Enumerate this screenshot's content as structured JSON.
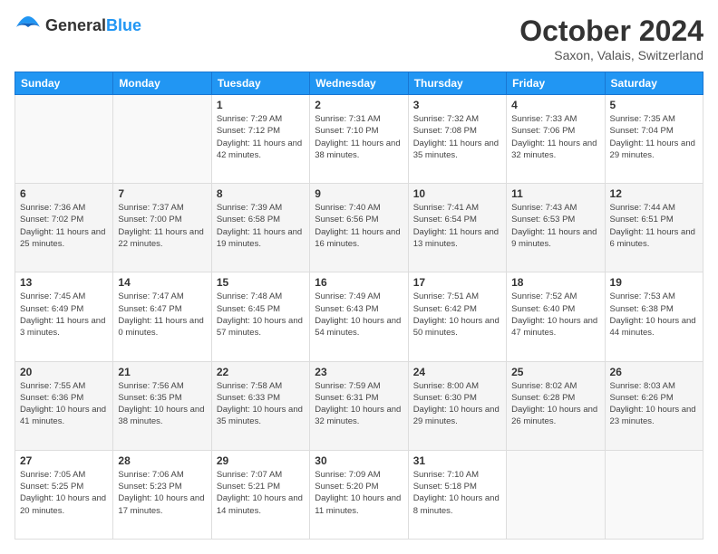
{
  "header": {
    "logo": {
      "general": "General",
      "blue": "Blue"
    },
    "title": "October 2024",
    "location": "Saxon, Valais, Switzerland"
  },
  "weekdays": [
    "Sunday",
    "Monday",
    "Tuesday",
    "Wednesday",
    "Thursday",
    "Friday",
    "Saturday"
  ],
  "weeks": [
    [
      {
        "day": "",
        "sunrise": "",
        "sunset": "",
        "daylight": ""
      },
      {
        "day": "",
        "sunrise": "",
        "sunset": "",
        "daylight": ""
      },
      {
        "day": "1",
        "sunrise": "Sunrise: 7:29 AM",
        "sunset": "Sunset: 7:12 PM",
        "daylight": "Daylight: 11 hours and 42 minutes."
      },
      {
        "day": "2",
        "sunrise": "Sunrise: 7:31 AM",
        "sunset": "Sunset: 7:10 PM",
        "daylight": "Daylight: 11 hours and 38 minutes."
      },
      {
        "day": "3",
        "sunrise": "Sunrise: 7:32 AM",
        "sunset": "Sunset: 7:08 PM",
        "daylight": "Daylight: 11 hours and 35 minutes."
      },
      {
        "day": "4",
        "sunrise": "Sunrise: 7:33 AM",
        "sunset": "Sunset: 7:06 PM",
        "daylight": "Daylight: 11 hours and 32 minutes."
      },
      {
        "day": "5",
        "sunrise": "Sunrise: 7:35 AM",
        "sunset": "Sunset: 7:04 PM",
        "daylight": "Daylight: 11 hours and 29 minutes."
      }
    ],
    [
      {
        "day": "6",
        "sunrise": "Sunrise: 7:36 AM",
        "sunset": "Sunset: 7:02 PM",
        "daylight": "Daylight: 11 hours and 25 minutes."
      },
      {
        "day": "7",
        "sunrise": "Sunrise: 7:37 AM",
        "sunset": "Sunset: 7:00 PM",
        "daylight": "Daylight: 11 hours and 22 minutes."
      },
      {
        "day": "8",
        "sunrise": "Sunrise: 7:39 AM",
        "sunset": "Sunset: 6:58 PM",
        "daylight": "Daylight: 11 hours and 19 minutes."
      },
      {
        "day": "9",
        "sunrise": "Sunrise: 7:40 AM",
        "sunset": "Sunset: 6:56 PM",
        "daylight": "Daylight: 11 hours and 16 minutes."
      },
      {
        "day": "10",
        "sunrise": "Sunrise: 7:41 AM",
        "sunset": "Sunset: 6:54 PM",
        "daylight": "Daylight: 11 hours and 13 minutes."
      },
      {
        "day": "11",
        "sunrise": "Sunrise: 7:43 AM",
        "sunset": "Sunset: 6:53 PM",
        "daylight": "Daylight: 11 hours and 9 minutes."
      },
      {
        "day": "12",
        "sunrise": "Sunrise: 7:44 AM",
        "sunset": "Sunset: 6:51 PM",
        "daylight": "Daylight: 11 hours and 6 minutes."
      }
    ],
    [
      {
        "day": "13",
        "sunrise": "Sunrise: 7:45 AM",
        "sunset": "Sunset: 6:49 PM",
        "daylight": "Daylight: 11 hours and 3 minutes."
      },
      {
        "day": "14",
        "sunrise": "Sunrise: 7:47 AM",
        "sunset": "Sunset: 6:47 PM",
        "daylight": "Daylight: 11 hours and 0 minutes."
      },
      {
        "day": "15",
        "sunrise": "Sunrise: 7:48 AM",
        "sunset": "Sunset: 6:45 PM",
        "daylight": "Daylight: 10 hours and 57 minutes."
      },
      {
        "day": "16",
        "sunrise": "Sunrise: 7:49 AM",
        "sunset": "Sunset: 6:43 PM",
        "daylight": "Daylight: 10 hours and 54 minutes."
      },
      {
        "day": "17",
        "sunrise": "Sunrise: 7:51 AM",
        "sunset": "Sunset: 6:42 PM",
        "daylight": "Daylight: 10 hours and 50 minutes."
      },
      {
        "day": "18",
        "sunrise": "Sunrise: 7:52 AM",
        "sunset": "Sunset: 6:40 PM",
        "daylight": "Daylight: 10 hours and 47 minutes."
      },
      {
        "day": "19",
        "sunrise": "Sunrise: 7:53 AM",
        "sunset": "Sunset: 6:38 PM",
        "daylight": "Daylight: 10 hours and 44 minutes."
      }
    ],
    [
      {
        "day": "20",
        "sunrise": "Sunrise: 7:55 AM",
        "sunset": "Sunset: 6:36 PM",
        "daylight": "Daylight: 10 hours and 41 minutes."
      },
      {
        "day": "21",
        "sunrise": "Sunrise: 7:56 AM",
        "sunset": "Sunset: 6:35 PM",
        "daylight": "Daylight: 10 hours and 38 minutes."
      },
      {
        "day": "22",
        "sunrise": "Sunrise: 7:58 AM",
        "sunset": "Sunset: 6:33 PM",
        "daylight": "Daylight: 10 hours and 35 minutes."
      },
      {
        "day": "23",
        "sunrise": "Sunrise: 7:59 AM",
        "sunset": "Sunset: 6:31 PM",
        "daylight": "Daylight: 10 hours and 32 minutes."
      },
      {
        "day": "24",
        "sunrise": "Sunrise: 8:00 AM",
        "sunset": "Sunset: 6:30 PM",
        "daylight": "Daylight: 10 hours and 29 minutes."
      },
      {
        "day": "25",
        "sunrise": "Sunrise: 8:02 AM",
        "sunset": "Sunset: 6:28 PM",
        "daylight": "Daylight: 10 hours and 26 minutes."
      },
      {
        "day": "26",
        "sunrise": "Sunrise: 8:03 AM",
        "sunset": "Sunset: 6:26 PM",
        "daylight": "Daylight: 10 hours and 23 minutes."
      }
    ],
    [
      {
        "day": "27",
        "sunrise": "Sunrise: 7:05 AM",
        "sunset": "Sunset: 5:25 PM",
        "daylight": "Daylight: 10 hours and 20 minutes."
      },
      {
        "day": "28",
        "sunrise": "Sunrise: 7:06 AM",
        "sunset": "Sunset: 5:23 PM",
        "daylight": "Daylight: 10 hours and 17 minutes."
      },
      {
        "day": "29",
        "sunrise": "Sunrise: 7:07 AM",
        "sunset": "Sunset: 5:21 PM",
        "daylight": "Daylight: 10 hours and 14 minutes."
      },
      {
        "day": "30",
        "sunrise": "Sunrise: 7:09 AM",
        "sunset": "Sunset: 5:20 PM",
        "daylight": "Daylight: 10 hours and 11 minutes."
      },
      {
        "day": "31",
        "sunrise": "Sunrise: 7:10 AM",
        "sunset": "Sunset: 5:18 PM",
        "daylight": "Daylight: 10 hours and 8 minutes."
      },
      {
        "day": "",
        "sunrise": "",
        "sunset": "",
        "daylight": ""
      },
      {
        "day": "",
        "sunrise": "",
        "sunset": "",
        "daylight": ""
      }
    ]
  ]
}
